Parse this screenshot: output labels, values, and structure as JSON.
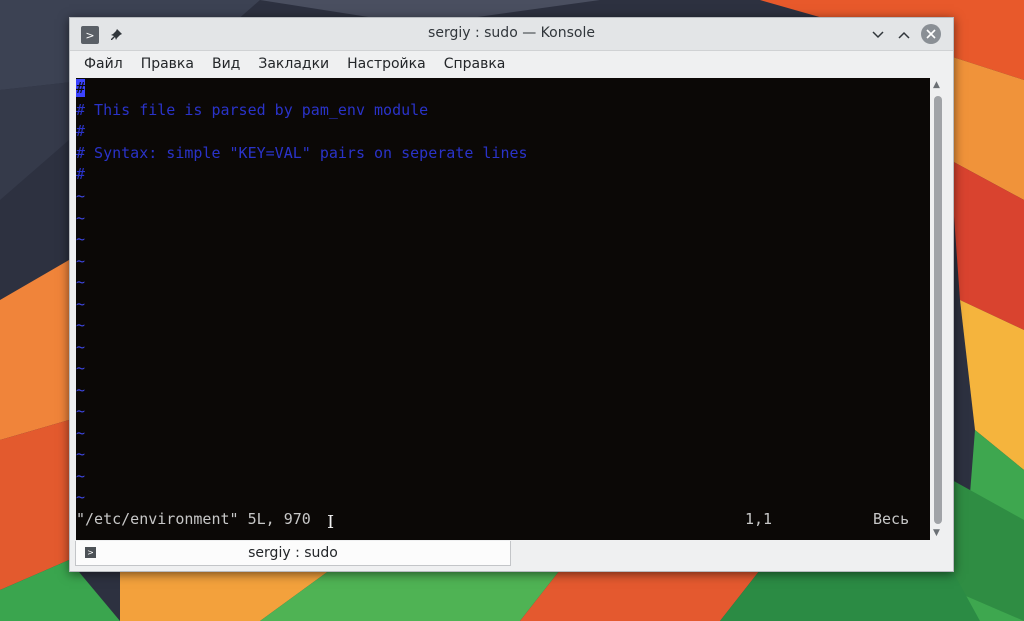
{
  "window": {
    "title": "sergiy : sudo — Konsole",
    "app_icon": "terminal-icon",
    "pin_icon": "pin-icon",
    "min_glyph": "⌵",
    "max_glyph": "^",
    "close_glyph": "✕"
  },
  "menu": [
    "Файл",
    "Правка",
    "Вид",
    "Закладки",
    "Настройка",
    "Справка"
  ],
  "editor": {
    "cursor_char": "#",
    "lines": [
      "# This file is parsed by pam_env module",
      "#",
      "# Syntax: simple \"KEY=VAL\" pairs on seperate lines",
      "#"
    ],
    "tilde": "~",
    "tilde_count": 15,
    "status_file": "\"/etc/environment\" 5L, 970",
    "status_pos": "1,1",
    "status_scope": "Весь"
  },
  "tab": {
    "label": "sergiy : sudo",
    "icon": "terminal-icon"
  },
  "colors": {
    "comment": "#2a33c9",
    "tilde": "#3d46e0",
    "cursor": "#3b43ff",
    "terminal_bg": "#0b0806",
    "window_bg": "#eff0f1"
  }
}
